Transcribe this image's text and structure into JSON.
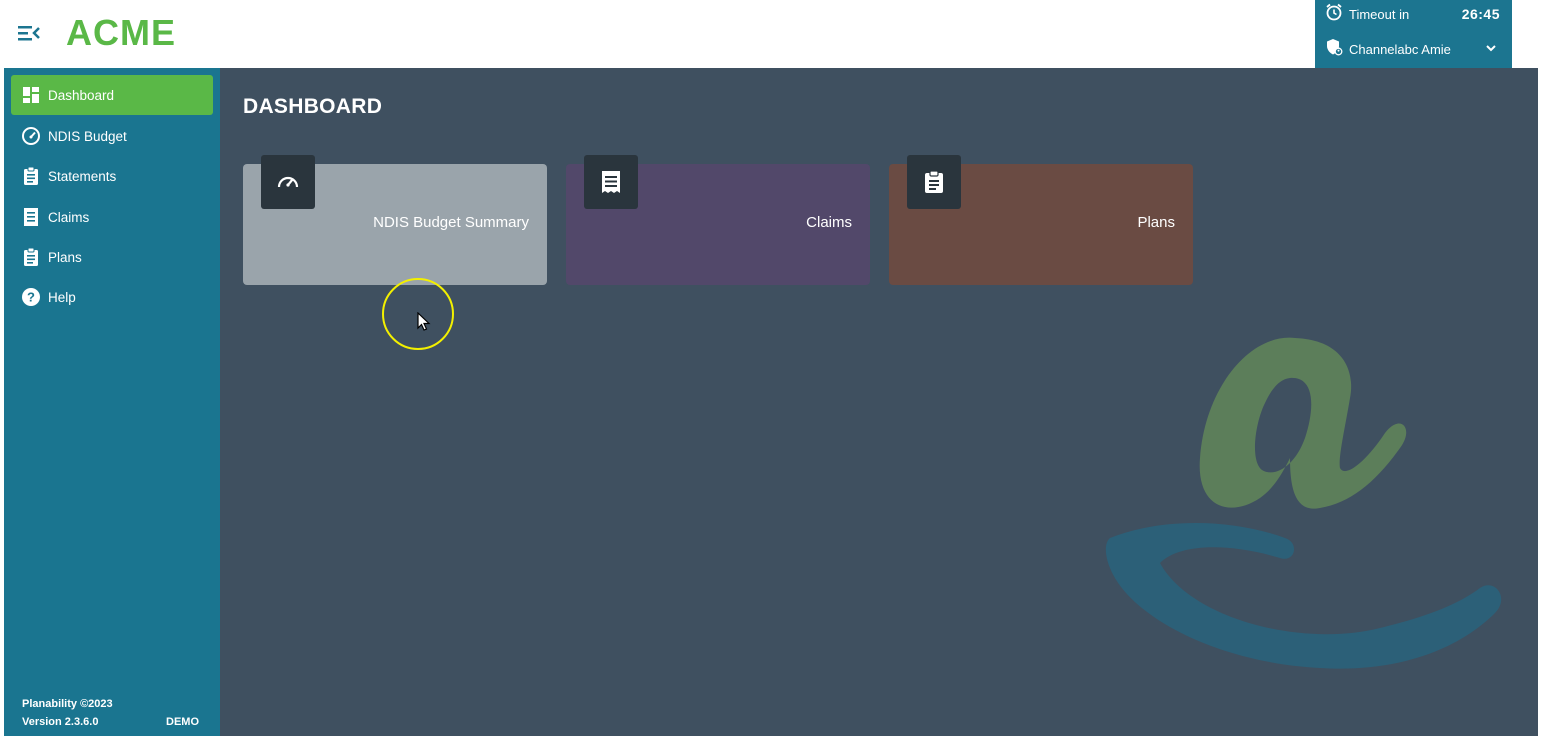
{
  "header": {
    "logo_text": "ACME",
    "session": {
      "timeout_label": "Timeout in",
      "timeout_value": "26:45",
      "user_name": "Channelabc Amie",
      "bg_color": "#1c7590"
    }
  },
  "sidebar": {
    "items": [
      {
        "label": "Dashboard",
        "icon": "dashboard-icon",
        "active": true
      },
      {
        "label": "NDIS Budget",
        "icon": "speedometer-icon",
        "active": false
      },
      {
        "label": "Statements",
        "icon": "clipboard-icon",
        "active": false
      },
      {
        "label": "Claims",
        "icon": "receipt-icon",
        "active": false
      },
      {
        "label": "Plans",
        "icon": "clipboard-icon",
        "active": false
      },
      {
        "label": "Help",
        "icon": "help-icon",
        "active": false
      }
    ],
    "footer": {
      "copyright": "Planability ©2023",
      "version": "Version 2.3.6.0",
      "env": "DEMO"
    },
    "accent_color": "#5ab847",
    "bg_color": "#1a7590"
  },
  "main": {
    "title": "DASHBOARD",
    "cards": [
      {
        "title": "NDIS Budget Summary",
        "icon": "speedometer-icon",
        "color": "#9aa4ab"
      },
      {
        "title": "Claims",
        "icon": "receipt-icon",
        "color": "#52486a"
      },
      {
        "title": "Plans",
        "icon": "clipboard-icon",
        "color": "#6a4b43"
      }
    ],
    "bg_color": "#3f5060"
  }
}
